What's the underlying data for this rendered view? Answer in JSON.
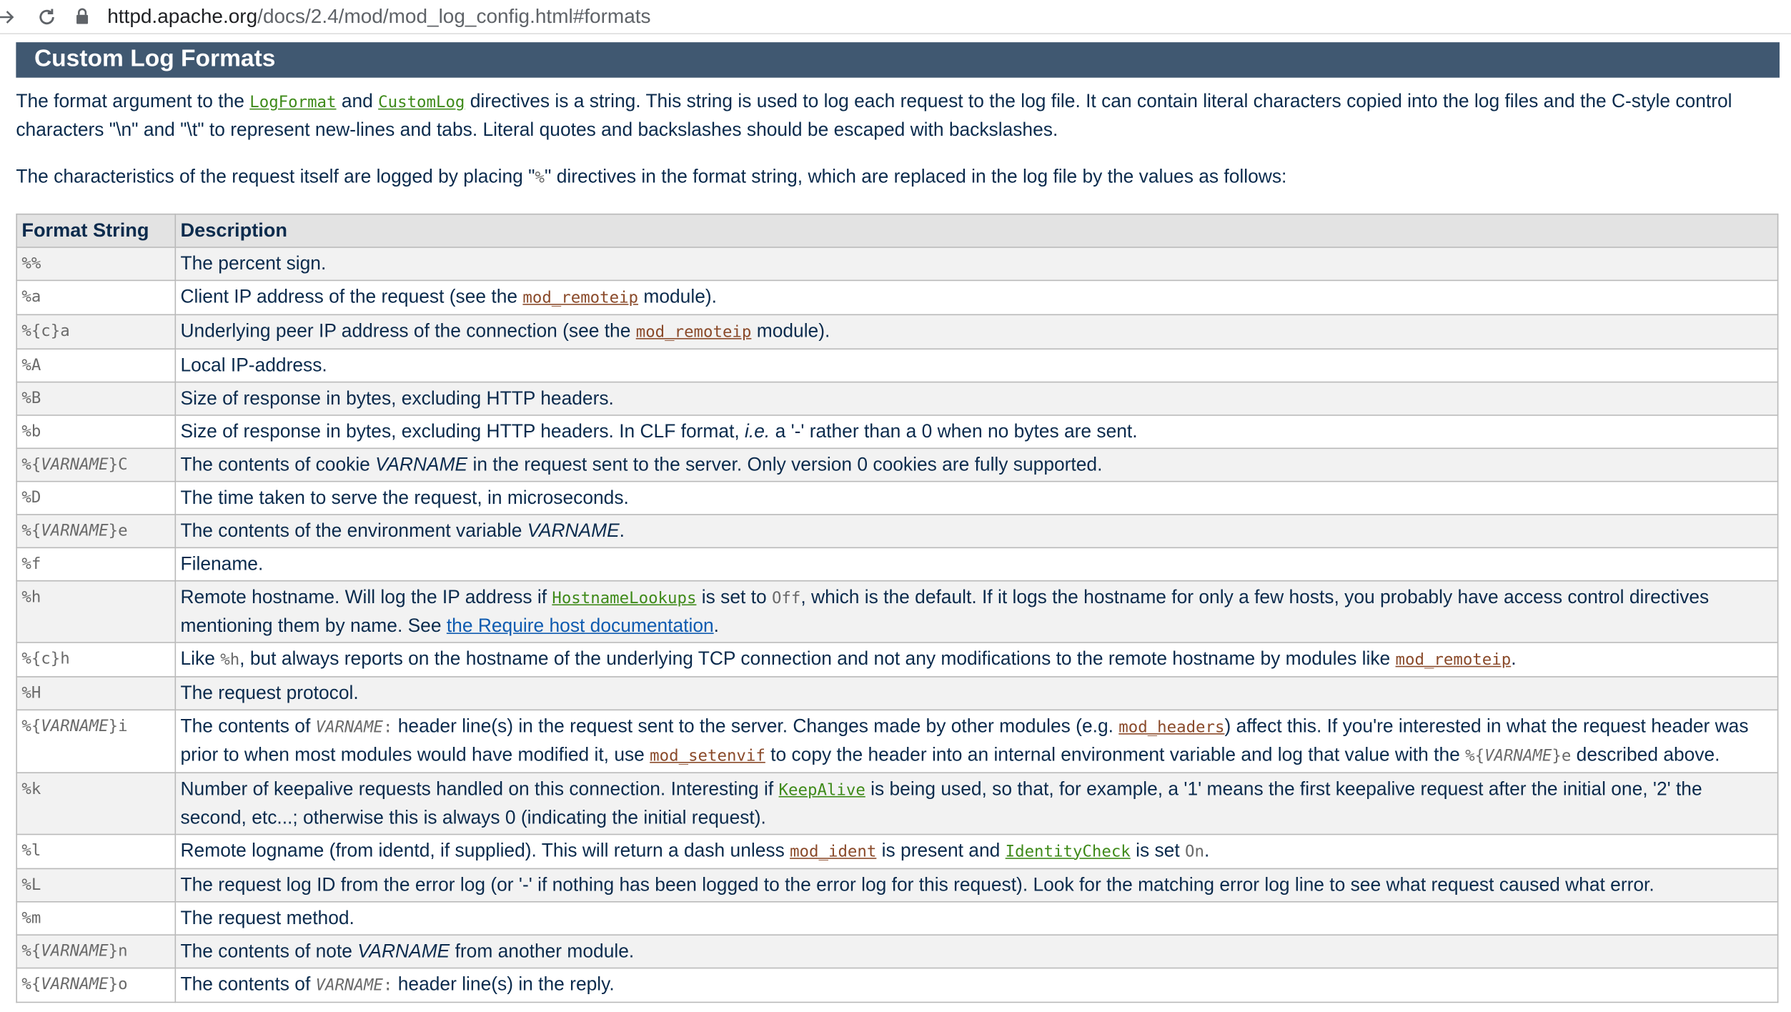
{
  "browser": {
    "url_host": "httpd.apache.org",
    "url_path": "/docs/2.4/mod/mod_log_config.html#formats"
  },
  "section": {
    "title": "Custom Log Formats"
  },
  "intro": {
    "p1_a": "The format argument to the ",
    "p1_link1": "LogFormat",
    "p1_b": " and ",
    "p1_link2": "CustomLog",
    "p1_c": " directives is a string. This string is used to log each request to the log file. It can contain literal characters copied into the log files and the C-style control characters \"\\n\" and \"\\t\" to represent new-lines and tabs. Literal quotes and backslashes should be escaped with backslashes.",
    "p2_a": "The characteristics of the request itself are logged by placing \"",
    "p2_code": "%",
    "p2_b": "\" directives in the format string, which are replaced in the log file by the values as follows:"
  },
  "table": {
    "headers": [
      "Format String",
      "Description"
    ],
    "rows": [
      {
        "fmt": "%%",
        "desc": "The percent sign."
      },
      {
        "fmt": "%a",
        "desc_a": "Client IP address of the request (see the ",
        "desc_link": "mod_remoteip",
        "desc_b": " module)."
      },
      {
        "fmt": "%{c}a",
        "desc_a": "Underlying peer IP address of the connection (see the ",
        "desc_link": "mod_remoteip",
        "desc_b": " module)."
      },
      {
        "fmt": "%A",
        "desc": "Local IP-address."
      },
      {
        "fmt": "%B",
        "desc": "Size of response in bytes, excluding HTTP headers."
      },
      {
        "fmt": "%b",
        "desc_a": "Size of response in bytes, excluding HTTP headers. In CLF format, ",
        "desc_i": "i.e.",
        "desc_b": " a '-' rather than a 0 when no bytes are sent."
      },
      {
        "fmt_a": "%{",
        "fmt_var": "VARNAME",
        "fmt_b": "}C",
        "desc_a": "The contents of cookie ",
        "desc_i": "VARNAME",
        "desc_b": " in the request sent to the server. Only version 0 cookies are fully supported."
      },
      {
        "fmt": "%D",
        "desc": "The time taken to serve the request, in microseconds."
      },
      {
        "fmt_a": "%{",
        "fmt_var": "VARNAME",
        "fmt_b": "}e",
        "desc_a": "The contents of the environment variable ",
        "desc_i": "VARNAME",
        "desc_b": "."
      },
      {
        "fmt": "%f",
        "desc": "Filename."
      },
      {
        "fmt": "%h",
        "desc_a": "Remote hostname. Will log the IP address if ",
        "desc_link": "HostnameLookups",
        "desc_b": " is set to ",
        "desc_code": "Off",
        "desc_c": ", which is the default. If it logs the hostname for only a few hosts, you probably have access control directives mentioning them by name. See ",
        "desc_link2": "the Require host documentation",
        "desc_d": "."
      },
      {
        "fmt": "%{c}h",
        "desc_a": "Like ",
        "desc_code": "%h",
        "desc_b": ", but always reports on the hostname of the underlying TCP connection and not any modifications to the remote hostname by modules like ",
        "desc_link": "mod_remoteip",
        "desc_c": "."
      },
      {
        "fmt": "%H",
        "desc": "The request protocol."
      },
      {
        "fmt_a": "%{",
        "fmt_var": "VARNAME",
        "fmt_b": "}i",
        "desc_a": "The contents of ",
        "desc_code_var": "VARNAME",
        "desc_code_colon": ":",
        "desc_b": " header line(s) in the request sent to the server. Changes made by other modules (e.g. ",
        "desc_link": "mod_headers",
        "desc_c": ") affect this. If you're interested in what the request header was prior to when most modules would have modified it, use ",
        "desc_link2": "mod_setenvif",
        "desc_d": " to copy the header into an internal environment variable and log that value with the ",
        "desc_code2_a": "%{",
        "desc_code2_var": "VARNAME",
        "desc_code2_b": "}e",
        "desc_e": " described above."
      },
      {
        "fmt": "%k",
        "desc_a": "Number of keepalive requests handled on this connection. Interesting if ",
        "desc_link": "KeepAlive",
        "desc_b": " is being used, so that, for example, a '1' means the first keepalive request after the initial one, '2' the second, etc...; otherwise this is always 0 (indicating the initial request)."
      },
      {
        "fmt": "%l",
        "desc_a": "Remote logname (from identd, if supplied). This will return a dash unless ",
        "desc_link": "mod_ident",
        "desc_b": " is present and ",
        "desc_link2": "IdentityCheck",
        "desc_c": " is set ",
        "desc_code": "On",
        "desc_d": "."
      },
      {
        "fmt": "%L",
        "desc": "The request log ID from the error log (or '-' if nothing has been logged to the error log for this request). Look for the matching error log line to see what request caused what error."
      },
      {
        "fmt": "%m",
        "desc": "The request method."
      },
      {
        "fmt_a": "%{",
        "fmt_var": "VARNAME",
        "fmt_b": "}n",
        "desc_a": "The contents of note ",
        "desc_i": "VARNAME",
        "desc_b": " from another module."
      },
      {
        "fmt_a": "%{",
        "fmt_var": "VARNAME",
        "fmt_b": "}o",
        "desc_a": "The contents of ",
        "desc_code_var": "VARNAME",
        "desc_code_colon": ":",
        "desc_b": " header line(s) in the reply."
      }
    ]
  },
  "colors": {
    "title_bar": "#405871",
    "text": "#0b2b4d",
    "module_link": "#8a4a2a",
    "directive_link": "#3e8a19",
    "doc_link": "#0f5bb0"
  }
}
